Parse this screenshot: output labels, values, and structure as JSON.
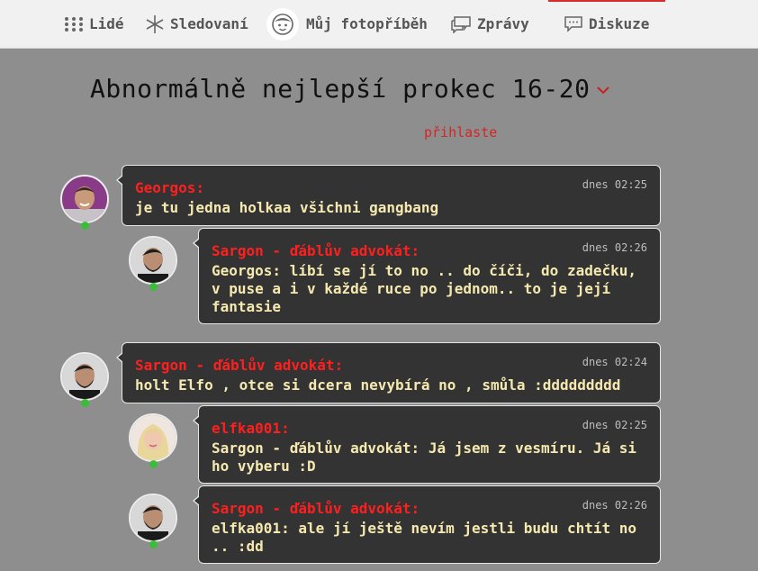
{
  "nav": {
    "people": "Lidé",
    "following": "Sledovaní",
    "my_story": "Můj fotopříběh",
    "messages": "Zprávy",
    "discussion": "Diskuze"
  },
  "page": {
    "title": "Abnormálně nejlepší prokec 16-20",
    "login_link": "přihlaste"
  },
  "posts": [
    {
      "author": "Georgos:",
      "time": "dnes 02:25",
      "text": "je tu jedna holkaa všichni gangbang"
    },
    {
      "author": "Sargon - ďáblův advokát:",
      "time": "dnes 02:26",
      "text": "Georgos: líbí se jí to no .. do číči, do zadečku, v puse a i v každé ruce po jednom.. to je její fantasie"
    },
    {
      "author": "Sargon - ďáblův advokát:",
      "time": "dnes 02:24",
      "text": "holt Elfo , otce si dcera nevybírá no , smůla :ddddddddd"
    },
    {
      "author": "elfka001:",
      "time": "dnes 02:25",
      "text": "Sargon - ďáblův advokát: Já jsem z vesmíru. Já si ho vyberu :D"
    },
    {
      "author": "Sargon - ďáblův advokát:",
      "time": "dnes 02:26",
      "text": "elfka001: ale jí ještě nevím jestli budu chtít no .. :dd"
    }
  ],
  "colors": {
    "background": "#8e8e8e",
    "bubble": "#333333",
    "author": "#ff1f1f",
    "message_text": "#f6e9b0",
    "online": "#3bbd3b",
    "accent": "#d52b2b"
  }
}
